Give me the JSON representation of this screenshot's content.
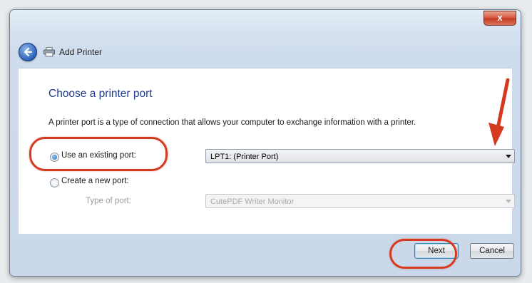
{
  "window": {
    "title": "Add Printer",
    "close_label": "x"
  },
  "page": {
    "title": "Choose a printer port",
    "description": "A printer port is a type of connection that allows your computer to exchange information with a printer."
  },
  "options": {
    "existing_label": "Use an existing port:",
    "existing_selected": true,
    "existing_value": "LPT1: (Printer Port)",
    "new_label": "Create a new port:",
    "new_selected": false,
    "type_label": "Type of port:",
    "type_value": "CutePDF Writer Monitor"
  },
  "buttons": {
    "next": "Next",
    "cancel": "Cancel"
  },
  "colors": {
    "annotation": "#d53a1f",
    "heading": "#1f3d8a"
  }
}
